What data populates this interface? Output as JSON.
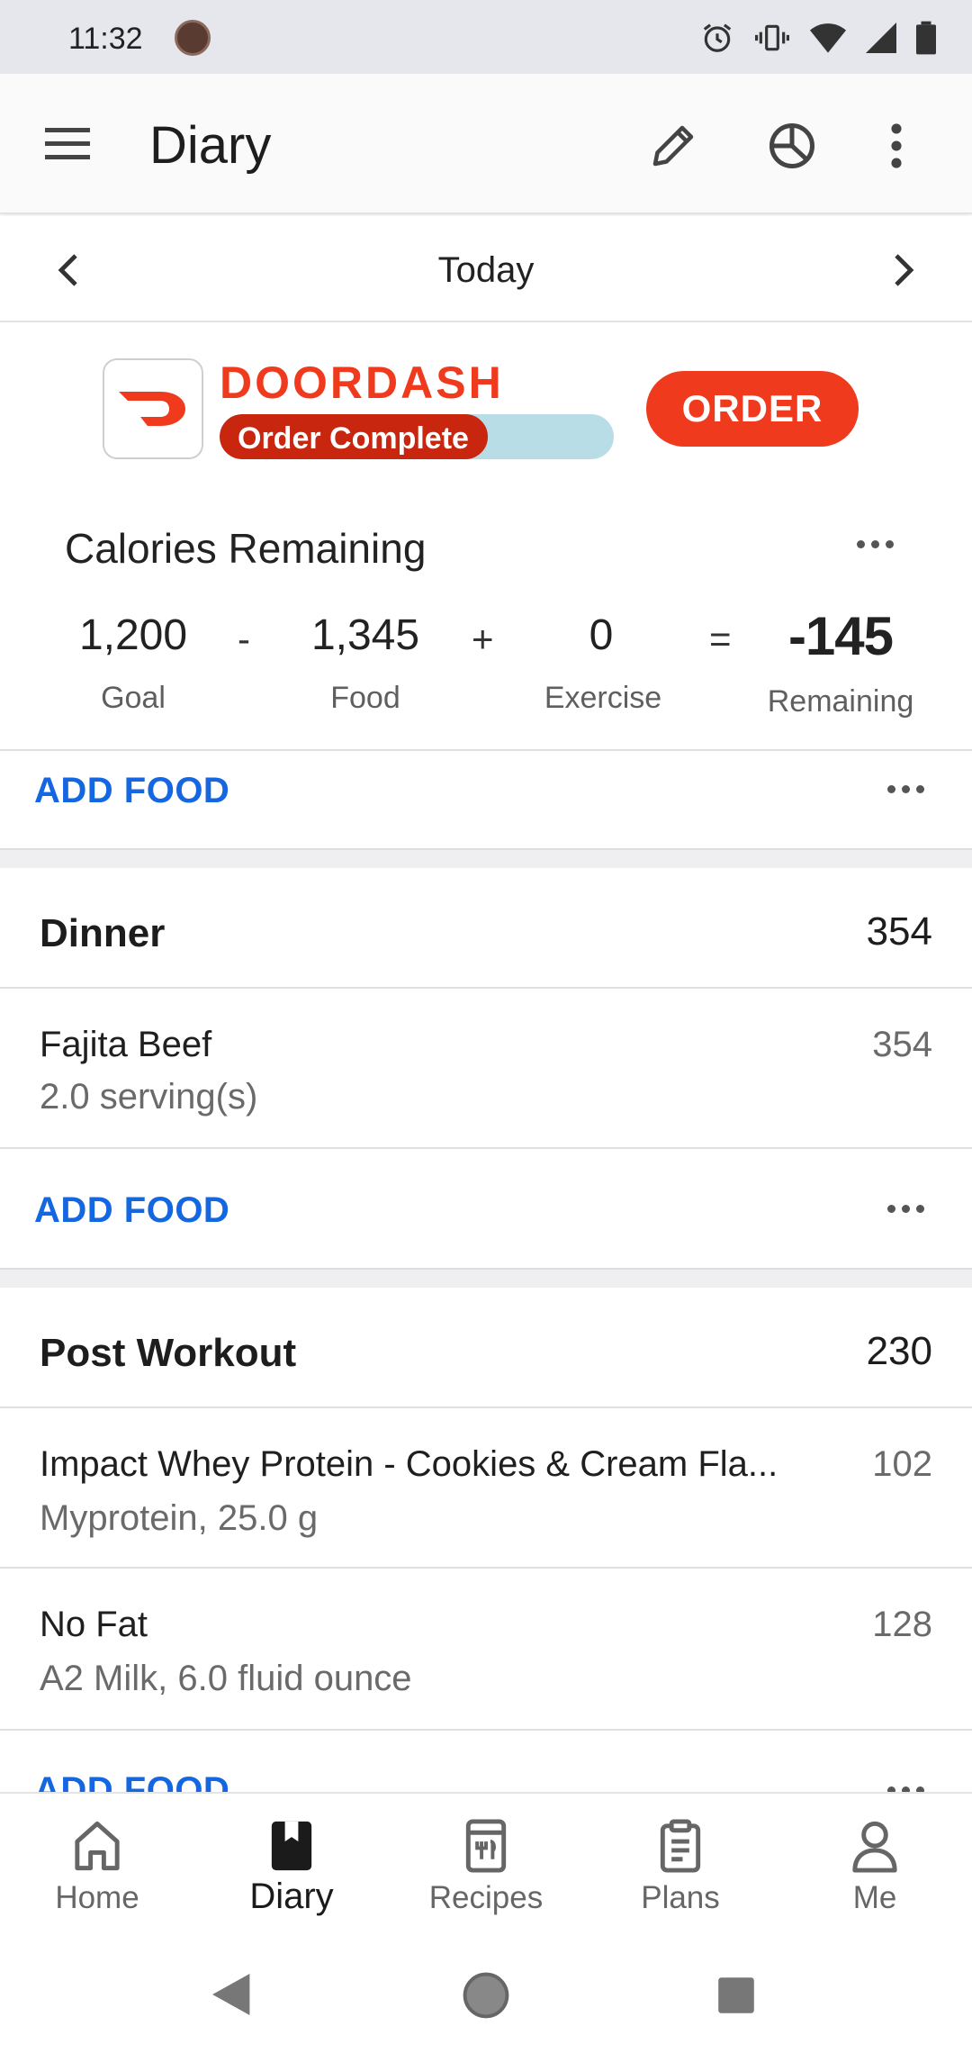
{
  "status_bar": {
    "time": "11:32"
  },
  "app_bar": {
    "title": "Diary"
  },
  "date_nav": {
    "label": "Today"
  },
  "ad": {
    "brand": "DOORDASH",
    "progress_text": "Order Complete",
    "progress": 0.68,
    "order_label": "ORDER",
    "colors": {
      "brand": "#ef3a1e",
      "progress_track": "#b9dde6"
    }
  },
  "calories": {
    "title": "Calories Remaining",
    "goal": {
      "value": "1,200",
      "label": "Goal"
    },
    "op1": "-",
    "food": {
      "value": "1,345",
      "label": "Food"
    },
    "op2": "+",
    "exercise": {
      "value": "0",
      "label": "Exercise"
    },
    "op3": "=",
    "remaining": {
      "value": "-145",
      "label": "Remaining"
    }
  },
  "add_food_label": "ADD FOOD",
  "meals": [
    {
      "name": "Dinner",
      "calories": "354",
      "items": [
        {
          "name": "Fajita Beef",
          "detail": "2.0 serving(s)",
          "calories": "354"
        }
      ]
    },
    {
      "name": "Post Workout",
      "calories": "230",
      "items": [
        {
          "name": "Impact Whey Protein - Cookies & Cream Fla...",
          "detail": "Myprotein, 25.0 g",
          "calories": "102"
        },
        {
          "name": "No Fat",
          "detail": "A2 Milk, 6.0 fluid ounce",
          "calories": "128"
        }
      ]
    }
  ],
  "bottom_nav": [
    {
      "label": "Home",
      "icon": "home-icon"
    },
    {
      "label": "Diary",
      "icon": "diary-icon",
      "active": true
    },
    {
      "label": "Recipes",
      "icon": "recipes-icon"
    },
    {
      "label": "Plans",
      "icon": "plans-icon"
    },
    {
      "label": "Me",
      "icon": "person-icon"
    }
  ],
  "accent_color": "#1467e0"
}
